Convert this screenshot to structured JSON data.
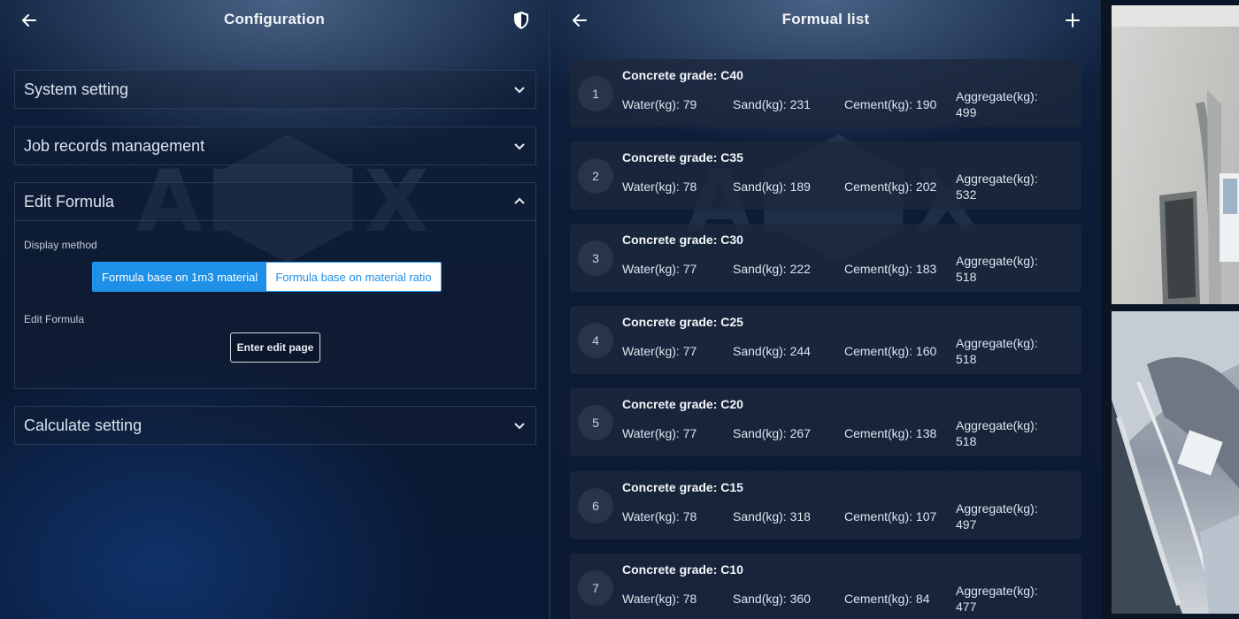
{
  "config": {
    "title": "Configuration",
    "sections": [
      {
        "label": "System setting",
        "expanded": false
      },
      {
        "label": "Job records management",
        "expanded": false
      },
      {
        "label": "Edit Formula",
        "expanded": true
      },
      {
        "label": "Calculate setting",
        "expanded": false
      }
    ],
    "edit_formula": {
      "display_method_label": "Display method",
      "options": [
        "Formula base on 1m3 material",
        "Formula base on material ratio"
      ],
      "selected_option": "Formula base on 1m3 material",
      "edit_label": "Edit Formula",
      "edit_button": "Enter edit page"
    }
  },
  "formula_list": {
    "title": "Formual list",
    "items": [
      {
        "index": "1",
        "grade": "Concrete grade: C40",
        "water": "Water(kg): 79",
        "sand": "Sand(kg): 231",
        "cement": "Cement(kg): 190",
        "aggregate_label": "Aggregate(kg):",
        "aggregate_value": "499"
      },
      {
        "index": "2",
        "grade": "Concrete grade: C35",
        "water": "Water(kg): 78",
        "sand": "Sand(kg): 189",
        "cement": "Cement(kg): 202",
        "aggregate_label": "Aggregate(kg):",
        "aggregate_value": "532"
      },
      {
        "index": "3",
        "grade": "Concrete grade: C30",
        "water": "Water(kg): 77",
        "sand": "Sand(kg): 222",
        "cement": "Cement(kg): 183",
        "aggregate_label": "Aggregate(kg):",
        "aggregate_value": "518"
      },
      {
        "index": "4",
        "grade": "Concrete grade: C25",
        "water": "Water(kg): 77",
        "sand": "Sand(kg): 244",
        "cement": "Cement(kg): 160",
        "aggregate_label": "Aggregate(kg):",
        "aggregate_value": "518"
      },
      {
        "index": "5",
        "grade": "Concrete grade: C20",
        "water": "Water(kg): 77",
        "sand": "Sand(kg): 267",
        "cement": "Cement(kg): 138",
        "aggregate_label": "Aggregate(kg):",
        "aggregate_value": "518"
      },
      {
        "index": "6",
        "grade": "Concrete grade: C15",
        "water": "Water(kg): 78",
        "sand": "Sand(kg): 318",
        "cement": "Cement(kg): 107",
        "aggregate_label": "Aggregate(kg):",
        "aggregate_value": "497"
      },
      {
        "index": "7",
        "grade": "Concrete grade: C10",
        "water": "Water(kg): 78",
        "sand": "Sand(kg): 360",
        "cement": "Cement(kg): 84",
        "aggregate_label": "Aggregate(kg):",
        "aggregate_value": "477"
      }
    ]
  },
  "watermark": "AIMIX",
  "icons": {
    "back": "arrow-left-icon",
    "shield": "shield-icon",
    "add": "plus-icon",
    "expand": "chevron-down-icon",
    "collapse": "chevron-up-icon"
  },
  "colors": {
    "accent": "#1e90e8",
    "background": "#0b1a33",
    "card": "#1c283c"
  }
}
